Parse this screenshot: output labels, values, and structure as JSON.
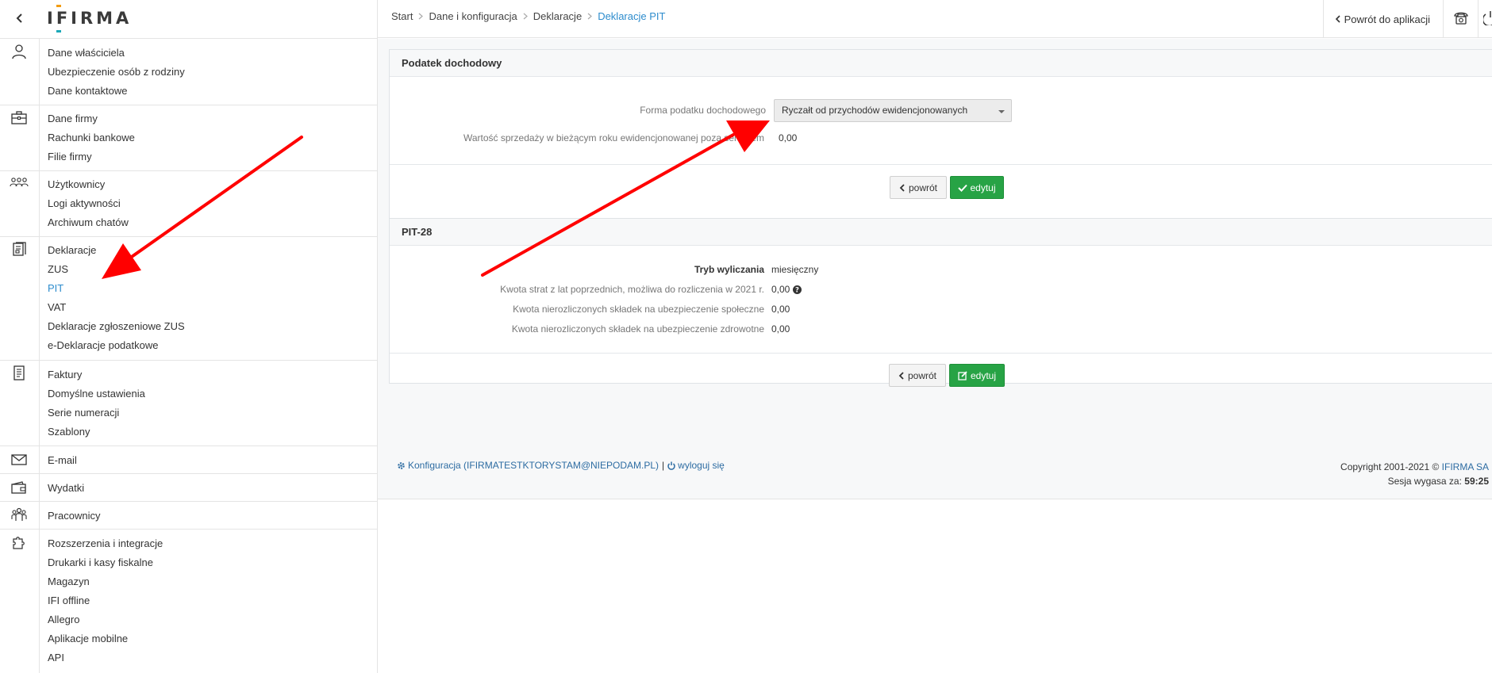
{
  "app": {
    "logo_text": "IFIRMA"
  },
  "sidebar": {
    "sections": [
      {
        "icon": "user-icon",
        "items": [
          "Dane właściciela",
          "Ubezpieczenie osób z rodziny",
          "Dane kontaktowe"
        ]
      },
      {
        "icon": "briefcase-icon",
        "items": [
          "Dane firmy",
          "Rachunki bankowe",
          "Filie firmy"
        ]
      },
      {
        "icon": "users-icon",
        "items": [
          "Użytkownicy",
          "Logi aktywności",
          "Archiwum chatów"
        ]
      },
      {
        "icon": "declarations-icon",
        "items": [
          "Deklaracje",
          "ZUS",
          "PIT",
          "VAT",
          "Deklaracje zgłoszeniowe ZUS",
          "e-Deklaracje podatkowe"
        ],
        "active": "PIT"
      },
      {
        "icon": "invoice-icon",
        "items": [
          "Faktury",
          "Domyślne ustawienia",
          "Serie numeracji",
          "Szablony"
        ]
      },
      {
        "icon": "envelope-icon",
        "items": [
          "E-mail"
        ]
      },
      {
        "icon": "wallet-icon",
        "items": [
          "Wydatki"
        ]
      },
      {
        "icon": "workers-icon",
        "items": [
          "Pracownicy"
        ]
      },
      {
        "icon": "puzzle-icon",
        "items": [
          "Rozszerzenia i integracje",
          "Drukarki i kasy fiskalne",
          "Magazyn",
          "IFI offline",
          "Allegro",
          "Aplikacje mobilne",
          "API"
        ]
      }
    ]
  },
  "breadcrumb": [
    "Start",
    "Dane i konfiguracja",
    "Deklaracje",
    "Deklaracje PIT"
  ],
  "topbar": {
    "back_to_app": "Powrót do aplikacji"
  },
  "income_tax": {
    "title": "Podatek dochodowy",
    "form_label": "Forma podatku dochodowego",
    "form_value": "Ryczałt od przychodów ewidencjonowanych",
    "sales_label": "Wartość sprzedaży w bieżącym roku ewidencjonowanej poza serwisem",
    "sales_value": "0,00",
    "back_label": "powrót",
    "edit_label": "edytuj"
  },
  "pit28": {
    "title": "PIT-28",
    "rows": [
      {
        "label": "Tryb wyliczania",
        "value": "miesięczny"
      },
      {
        "label": "Kwota strat z lat poprzednich, możliwa do rozliczenia w 2021 r.",
        "value": "0,00"
      },
      {
        "label": "Kwota nierozliczonych składek na ubezpieczenie społeczne",
        "value": "0,00"
      },
      {
        "label": "Kwota nierozliczonych składek na ubezpieczenie zdrowotne",
        "value": "0,00"
      }
    ],
    "back_label": "powrót",
    "edit_label": "edytuj"
  },
  "footer": {
    "config_link": "Konfiguracja (IFIRMATESTKTORYSTAM@NIEPODAM.PL)",
    "separator": "|",
    "logout_link": "wyloguj się",
    "copyright_prefix": "Copyright 2001-2021 ©",
    "copyright_company": "IFIRMA SA",
    "session_label": "Sesja wygasa za:",
    "session_time": "59:25"
  },
  "colors": {
    "accent": "#2d8ccd",
    "success": "#27a345",
    "annotation_arrow": "#ff0000"
  }
}
